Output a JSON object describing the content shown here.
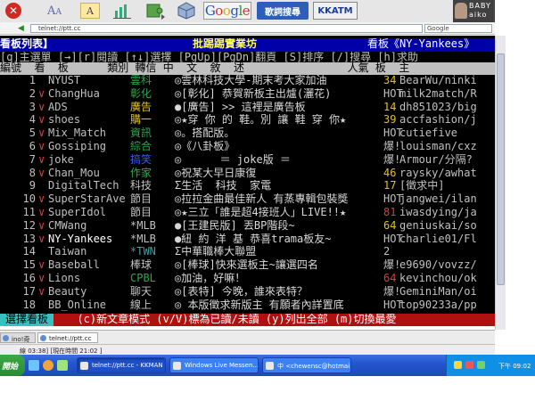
{
  "toolbar": {
    "close_icon": "close-icon",
    "google_parts": [
      "G",
      "o",
      "o",
      "g",
      "l",
      "e"
    ],
    "search2_label": "歌詞搜尋",
    "kkatm_label": "KKATM",
    "baby_line1": "BABY",
    "baby_line2": "aiko"
  },
  "address": {
    "url": "telnet://ptt.cc",
    "search_value": "Google"
  },
  "terminal": {
    "title_left": "看板列表】",
    "title_center": "批踢踢實業坊",
    "title_right": "看板《NY-Yankees》",
    "help_line": "[q]主選單 [→][r]閱讀 [↑↓]選擇 [PgUp][PgDn]翻頁 [S]排序 [/]搜尋 [h]求助",
    "header": "編號  看  板      類別 轉信 中  文  敘  述                人氣 板  主",
    "rows": [
      {
        "no": "1",
        "mark": "",
        "board": "NYUST",
        "cls": "雲科",
        "cls_color": "#2ea84a",
        "desc": "◎雲林科技大學-期末考大家加油",
        "pop": "34",
        "pop_color": "#e0c020",
        "mod": "BearWu/ninki"
      },
      {
        "no": "2",
        "mark": "∨",
        "board": "ChangHua",
        "cls": "彰化",
        "cls_color": "#2ea84a",
        "desc": "◎[彰化] 恭賀新板主出爐(灑花)",
        "pop": "HOT",
        "pop_color": "#c0c0c0",
        "mod": "milk2match/R"
      },
      {
        "no": "3",
        "mark": "∨",
        "board": "ADS",
        "cls": "廣告",
        "cls_color": "#e0c020",
        "desc": "●[廣告] >> 這裡是廣告板",
        "pop": "14",
        "pop_color": "#e0c020",
        "mod": "dh851023/big"
      },
      {
        "no": "4",
        "mark": "∨",
        "board": "shoes",
        "cls": "購一",
        "cls_color": "#e0c020",
        "desc": "◎★穿 你 的 鞋。別 讓 鞋 穿 你★",
        "pop": "39",
        "pop_color": "#e0c020",
        "mod": "accfashion/j"
      },
      {
        "no": "5",
        "mark": "∨",
        "board": "Mix_Match",
        "cls": "資訊",
        "cls_color": "#2ea84a",
        "desc": "◎。搭配版。",
        "pop": "HOT",
        "pop_color": "#c0c0c0",
        "mod": "cutiefive"
      },
      {
        "no": "6",
        "mark": "∨",
        "board": "Gossiping",
        "cls": "綜合",
        "cls_color": "#2ea84a",
        "desc": "◎《八卦板》",
        "pop": "爆!",
        "pop_color": "#c0c0c0",
        "mod": "louisman/cxz"
      },
      {
        "no": "7",
        "mark": "∨",
        "board": "joke",
        "cls": "搞笑",
        "cls_color": "#3a58e8",
        "desc": "◎      ＝ joke版 ＝",
        "pop": "爆!",
        "pop_color": "#c0c0c0",
        "mod": "Armour/分隔?"
      },
      {
        "no": "8",
        "mark": "∨",
        "board": "Chan_Mou",
        "cls": "作家",
        "cls_color": "#2ea84a",
        "desc": "◎祝某大早日康復",
        "pop": "46",
        "pop_color": "#e0c020",
        "mod": "raysky/awhat"
      },
      {
        "no": "9",
        "mark": "",
        "board": "DigitalTech",
        "cls": "科技",
        "cls_color": "#c0c0c0",
        "desc": "Σ生活  科技  家電",
        "pop": "17",
        "pop_color": "#e0c020",
        "mod": "[徵求中]"
      },
      {
        "no": "10",
        "mark": "∨",
        "board": "SuperStarAve",
        "cls": "節目",
        "cls_color": "#c0c0c0",
        "desc": "◎拉拉金曲最佳新人 有蒸專輯包裝獎",
        "pop": "HOT",
        "pop_color": "#c0c0c0",
        "mod": "jangwei/ilan"
      },
      {
        "no": "11",
        "mark": "∨",
        "board": "SuperIdol",
        "cls": "節目",
        "cls_color": "#c0c0c0",
        "desc": "◎★三立「誰是超4接班人」LIVE!!★",
        "pop": "81",
        "pop_color": "#e03a3a",
        "mod": "iwasdying/ja"
      },
      {
        "no": "12",
        "mark": "∨",
        "board": "CMWang",
        "cls": "*MLB",
        "cls_color": "#c0c0c0",
        "desc": "●[王建民版] 丟BP階段~",
        "pop": "64",
        "pop_color": "#e0c020",
        "mod": "geniuskai/so"
      },
      {
        "no": "13",
        "mark": "∨",
        "board": "NY-Yankees",
        "cls": "*MLB",
        "cls_color": "#c0c0c0",
        "desc": "●紐 約 洋 基 恭喜trama板友~",
        "pop": "HOT",
        "pop_color": "#c0c0c0",
        "mod": "charlie01/Fl",
        "sel": true
      },
      {
        "no": "14",
        "mark": "",
        "board": "Taiwan",
        "cls": "*TWN",
        "cls_color": "#3aa0a0",
        "desc": "Σ中華職棒大聯盟",
        "pop": "2",
        "pop_color": "#c0c0c0",
        "mod": ""
      },
      {
        "no": "15",
        "mark": "∨",
        "board": "Baseball",
        "cls": "棒球",
        "cls_color": "#c0c0c0",
        "desc": "◎[棒球]快來選板主~讓選四名",
        "pop": "爆!",
        "pop_color": "#c0c0c0",
        "mod": "e9690/vovzz/"
      },
      {
        "no": "16",
        "mark": "∨",
        "board": "Lions",
        "cls": "CPBL",
        "cls_color": "#2ea84a",
        "desc": "◎加油，好嘛！",
        "pop": "64",
        "pop_color": "#e03a3a",
        "mod": "kevinchou/ok"
      },
      {
        "no": "17",
        "mark": "∨",
        "board": "Beauty",
        "cls": "聊天",
        "cls_color": "#c0c0c0",
        "desc": "◎[表特] 今晚，誰來表特？",
        "pop": "爆!",
        "pop_color": "#c0c0c0",
        "mod": "GeminiMan/oi"
      },
      {
        "no": "18",
        "mark": "",
        "board": "BB_Online",
        "cls": "線上",
        "cls_color": "#c0c0c0",
        "desc": "◎ 本版徵求新版主 有願者內詳置底",
        "pop": "HOT",
        "pop_color": "#c0c0c0",
        "mod": "top90233a/pp"
      }
    ],
    "footer_sel": "選擇看板",
    "footer_rest": "  (c)新文章模式 (v/V)標為已讀/未讀 (y)列出全部 (m)切換最愛"
  },
  "tabs": [
    {
      "label": "ino!奇摩",
      "active": false
    },
    {
      "label": "telnet://ptt.cc",
      "active": true
    }
  ],
  "status": {
    "text": "線 03:38] [現在時間 21:02 ]"
  },
  "taskbar": {
    "start_label": "開始",
    "tasks": [
      {
        "label": "telnet://ptt.cc - KKMAN",
        "active": true
      },
      {
        "label": "Windows Live Messen...",
        "active": false
      },
      {
        "label": "中 <chewensc@hotmai...",
        "active": false
      }
    ],
    "clock": "下午 09:02"
  }
}
